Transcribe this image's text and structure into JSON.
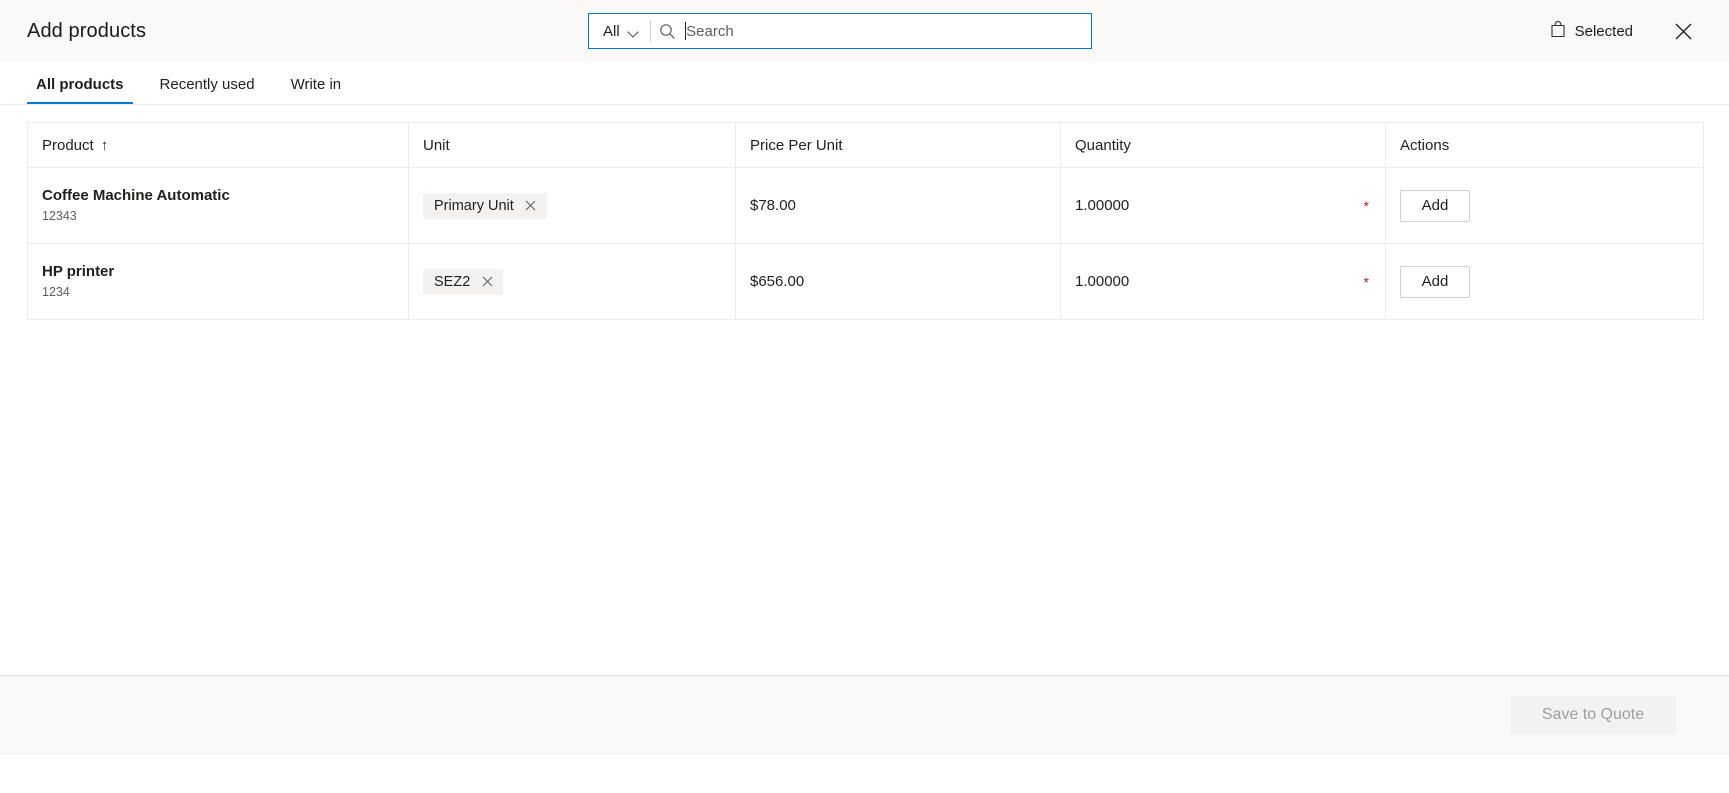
{
  "header": {
    "title": "Add products",
    "search": {
      "scope_label": "All",
      "scope_icon": "chevron-down-icon",
      "search_icon": "search-icon",
      "placeholder": "Search",
      "value": ""
    },
    "selected_label": "Selected",
    "selected_icon": "shopping-bag-icon",
    "close_icon": "close-icon"
  },
  "tabs": [
    {
      "label": "All products",
      "active": true
    },
    {
      "label": "Recently used",
      "active": false
    },
    {
      "label": "Write in",
      "active": false
    }
  ],
  "table": {
    "columns": [
      {
        "label": "Product",
        "sort": "↑"
      },
      {
        "label": "Unit"
      },
      {
        "label": "Price Per Unit"
      },
      {
        "label": "Quantity"
      },
      {
        "label": "Actions"
      }
    ],
    "rows": [
      {
        "product_name": "Coffee Machine Automatic",
        "product_id": "12343",
        "unit": "Primary Unit",
        "unit_remove_icon": "close-icon",
        "price": "$78.00",
        "quantity": "1.00000",
        "required_marker": "*",
        "action_label": "Add"
      },
      {
        "product_name": "HP printer",
        "product_id": "1234",
        "unit": "SEZ2",
        "unit_remove_icon": "close-icon",
        "price": "$656.00",
        "quantity": "1.00000",
        "required_marker": "*",
        "action_label": "Add"
      }
    ]
  },
  "footer": {
    "save_label": "Save to Quote",
    "save_disabled": true
  },
  "colors": {
    "accent": "#0078d4",
    "header_bg": "#faf9f8",
    "text": "#201f1e",
    "muted_text": "#605e5c",
    "border": "#edebe9",
    "pill_bg": "#f3f2f1",
    "required": "#a4262c",
    "disabled_text": "#a19f9d"
  }
}
